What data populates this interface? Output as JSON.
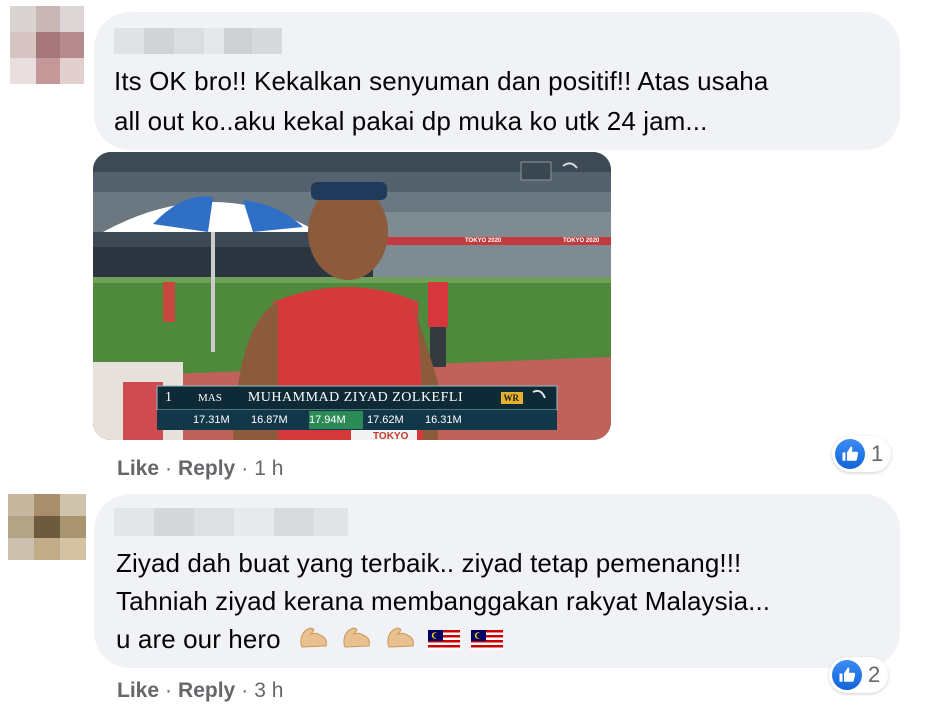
{
  "comments": [
    {
      "text_lines": [
        "Its OK bro!! Kekalkan senyuman dan positif!! Atas usaha",
        "all out ko..aku kekal pakai dp muka ko utk 24 jam..."
      ],
      "actions": {
        "like": "Like",
        "reply": "Reply",
        "time": "1 h",
        "dot": "·"
      },
      "reaction_count": "1",
      "photo": {
        "scoreboard": {
          "rank": "1",
          "country": "MAS",
          "athlete": "MUHAMMAD ZIYAD ZOLKEFLI",
          "badge": "WR",
          "attempts": [
            "17.31M",
            "16.87M",
            "17.94M",
            "17.62M",
            "16.31M"
          ]
        },
        "signage": [
          "TOKYO 2020",
          "TOKYO 2020",
          "TOKYO"
        ]
      }
    },
    {
      "text_lines": [
        "Ziyad dah buat yang terbaik.. ziyad tetap pemenang!!!",
        "Tahniah ziyad kerana membanggakan rakyat Malaysia...",
        "u are our hero"
      ],
      "actions": {
        "like": "Like",
        "reply": "Reply",
        "time": "3 h",
        "dot": "·"
      },
      "reaction_count": "2"
    }
  ],
  "icons": {
    "like_reaction": "thumbs-up-icon",
    "emoji_arm": "flexed-biceps-emoji",
    "emoji_flag": "malaysia-flag-emoji"
  },
  "colors": {
    "bubble": "#f0f2f5",
    "like_blue": "#1877f2",
    "secondary_text": "#65676b"
  }
}
